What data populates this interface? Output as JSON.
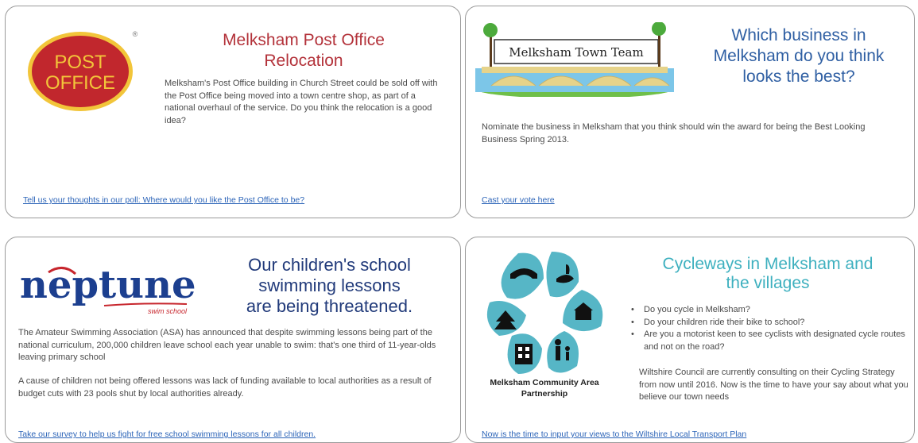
{
  "post_office": {
    "logo_text_line1": "POST",
    "logo_text_line2": "OFFICE",
    "logo_mark": "®",
    "title_line1": "Melksham Post Office",
    "title_line2": "Relocation",
    "body": "Melksham's Post Office building in Church Street could be sold off with the Post Office being moved into a town centre shop, as part of a national overhaul of the service. Do you think the relocation is a good idea?",
    "link": "Tell us your thoughts in our poll: Where would you like the Post Office to be?"
  },
  "town_team": {
    "logo_text": "Melksham Town Team",
    "title_line1": "Which business in",
    "title_line2": "Melksham do you think",
    "title_line3": "looks the best?",
    "body": "Nominate the business in Melksham that you think should win the award for being the Best Looking Business Spring 2013.",
    "link": "Cast your vote here"
  },
  "neptune": {
    "logo_text": "neptune",
    "logo_sub": "swim school",
    "title_line1": "Our children's school",
    "title_line2": "swimming lessons",
    "title_line3": "are being threatened.",
    "body1": "The Amateur Swimming Association (ASA) has announced that despite swimming lessons being part of the national curriculum, 200,000 children leave school each year unable to swim: that's one third of 11-year-olds leaving primary school",
    "body2": "A cause of children not being offered lessons was lack of funding available to local authorities as a result of budget cuts with 23 pools shut by local authorities already.",
    "link": "Take our survey to help us fight for free school swimming lessons for all children."
  },
  "cycleways": {
    "org_line1": "Melksham Community Area",
    "org_line2": "Partnership",
    "title_line1": "Cycleways in Melksham and",
    "title_line2": "the villages",
    "bullets": [
      "Do you cycle in Melksham?",
      "Do your children ride their bike to school?",
      "Are you a motorist keen to see cyclists with designated cycle routes and not on the road?"
    ],
    "body": "Wiltshire Council are currently consulting on their Cycling Strategy from now until 2016. Now is the time to have your say about what you believe our town needs",
    "link": "Now is the time to input your views to the Wiltshire Local Transport Plan"
  },
  "colors": {
    "post_office_red": "#b3323a",
    "town_team_blue": "#2f5fa3",
    "neptune_navy": "#213a7a",
    "cycle_teal": "#3eb0bf",
    "link_blue": "#2c64b8"
  }
}
